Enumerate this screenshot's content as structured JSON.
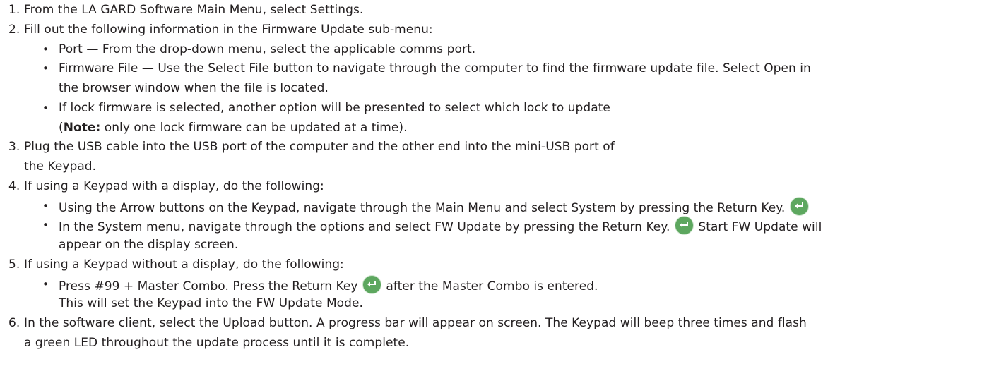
{
  "steps": [
    {
      "number": "1.",
      "text": "From the LA GARD Software Main Menu, select Settings."
    },
    {
      "number": "2.",
      "text": "Fill out the following information in the Firmware Update sub-menu:",
      "bullets": [
        {
          "text": "Port — From the drop-down menu, select the applicable comms port."
        },
        {
          "line1": "Firmware File — Use the Select File button to navigate through the computer to find the firmware update file. Select Open in",
          "line2": "the browser window when the file is located."
        },
        {
          "line1": "If lock firmware is selected, another option will be presented to select which lock to update",
          "note_open": "(",
          "note_label": "Note:",
          "note_text": " only one lock firmware can be updated at a time)."
        }
      ]
    },
    {
      "number": "3.",
      "line1": "Plug the USB cable into the USB port of the computer and the other end into the mini-USB port of",
      "line2": "the Keypad."
    },
    {
      "number": "4.",
      "text": "If using a Keypad with a display, do the following:",
      "bullets": [
        {
          "text": "Using the Arrow buttons on the Keypad, navigate through the Main Menu and select System by pressing the Return Key."
        },
        {
          "text_before": "In the System menu, navigate through the options and select FW Update by pressing the Return Key.",
          "text_after": "Start FW Update will",
          "line2": "appear on the display screen."
        }
      ]
    },
    {
      "number": "5.",
      "text": "If using a Keypad without a display, do the following:",
      "bullets": [
        {
          "text_before": "Press #99 + Master Combo. Press the Return Key",
          "text_after": "after the Master Combo is entered.",
          "line2": "This will set the Keypad into the FW Update Mode."
        }
      ]
    },
    {
      "number": "6.",
      "line1": "In the software client, select the Upload button. A progress bar will appear on screen. The Keypad will beep three times and flash",
      "line2": "a green LED throughout the update process until it is complete."
    }
  ],
  "icons": {
    "return_key": "return-key-icon",
    "bullet": "•"
  },
  "colors": {
    "text": "#231f20",
    "return_key_fill": "#5da75f"
  }
}
